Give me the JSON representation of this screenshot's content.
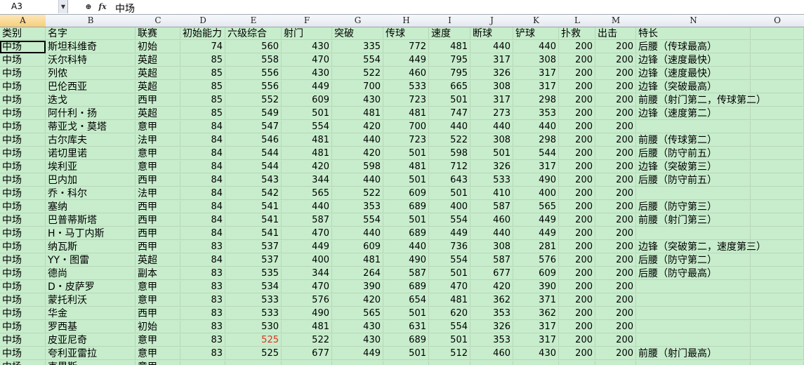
{
  "formula_bar": {
    "name_box": "A3",
    "content": "中场",
    "icons": [
      "zoom-icon",
      "function-icon"
    ]
  },
  "columns": [
    "A",
    "B",
    "C",
    "D",
    "E",
    "F",
    "G",
    "H",
    "I",
    "J",
    "K",
    "L",
    "M",
    "N",
    "O"
  ],
  "selected_column": "A",
  "header_row": [
    "类别",
    "名字",
    "联赛",
    "初始能力",
    "六级综合",
    "射门",
    "突破",
    "传球",
    "速度",
    "断球",
    "铲球",
    "扑救",
    "出击",
    "特长",
    ""
  ],
  "rows": [
    [
      "中场",
      "斯坦科维奇",
      "初始",
      "74",
      "560",
      "430",
      "335",
      "772",
      "481",
      "440",
      "440",
      "200",
      "200",
      "后腰（传球最高）"
    ],
    [
      "中场",
      "沃尔科特",
      "英超",
      "85",
      "558",
      "470",
      "554",
      "449",
      "795",
      "317",
      "308",
      "200",
      "200",
      "边锋（速度最快）"
    ],
    [
      "中场",
      "列侬",
      "英超",
      "85",
      "556",
      "430",
      "522",
      "460",
      "795",
      "326",
      "317",
      "200",
      "200",
      "边锋（速度最快）"
    ],
    [
      "中场",
      "巴伦西亚",
      "英超",
      "85",
      "556",
      "449",
      "700",
      "533",
      "665",
      "308",
      "317",
      "200",
      "200",
      "边锋（突破最高）"
    ],
    [
      "中场",
      "迭戈",
      "西甲",
      "85",
      "552",
      "609",
      "430",
      "723",
      "501",
      "317",
      "298",
      "200",
      "200",
      "前腰（射门第二，传球第二）"
    ],
    [
      "中场",
      "阿什利・扬",
      "英超",
      "85",
      "549",
      "501",
      "481",
      "481",
      "747",
      "273",
      "353",
      "200",
      "200",
      "边锋（速度第二）"
    ],
    [
      "中场",
      "蒂亚戈・莫塔",
      "意甲",
      "84",
      "547",
      "554",
      "420",
      "700",
      "440",
      "440",
      "440",
      "200",
      "200",
      ""
    ],
    [
      "中场",
      "古尔库夫",
      "法甲",
      "84",
      "546",
      "481",
      "440",
      "723",
      "522",
      "308",
      "298",
      "200",
      "200",
      "前腰（传球第二）"
    ],
    [
      "中场",
      "诺切里诺",
      "意甲",
      "84",
      "544",
      "481",
      "420",
      "501",
      "598",
      "501",
      "544",
      "200",
      "200",
      "后腰（防守前五）"
    ],
    [
      "中场",
      "埃利亚",
      "意甲",
      "84",
      "544",
      "420",
      "598",
      "481",
      "712",
      "326",
      "317",
      "200",
      "200",
      "边锋（突破第三）"
    ],
    [
      "中场",
      "巴内加",
      "西甲",
      "84",
      "543",
      "344",
      "440",
      "501",
      "643",
      "533",
      "490",
      "200",
      "200",
      "后腰（防守前五）"
    ],
    [
      "中场",
      "乔・科尔",
      "法甲",
      "84",
      "542",
      "565",
      "522",
      "609",
      "501",
      "410",
      "400",
      "200",
      "200",
      ""
    ],
    [
      "中场",
      "塞纳",
      "西甲",
      "84",
      "541",
      "440",
      "353",
      "689",
      "400",
      "587",
      "565",
      "200",
      "200",
      "后腰（防守第三）"
    ],
    [
      "中场",
      "巴普蒂斯塔",
      "西甲",
      "84",
      "541",
      "587",
      "554",
      "501",
      "554",
      "460",
      "449",
      "200",
      "200",
      "前腰（射门第三）"
    ],
    [
      "中场",
      "H・马丁内斯",
      "西甲",
      "84",
      "541",
      "470",
      "440",
      "689",
      "449",
      "440",
      "449",
      "200",
      "200",
      ""
    ],
    [
      "中场",
      "纳瓦斯",
      "西甲",
      "83",
      "537",
      "449",
      "609",
      "440",
      "736",
      "308",
      "281",
      "200",
      "200",
      "边锋（突破第二，速度第三）"
    ],
    [
      "中场",
      "YY・图雷",
      "英超",
      "84",
      "537",
      "400",
      "481",
      "490",
      "554",
      "587",
      "576",
      "200",
      "200",
      "后腰（防守第二）"
    ],
    [
      "中场",
      "德尚",
      "副本",
      "83",
      "535",
      "344",
      "264",
      "587",
      "501",
      "677",
      "609",
      "200",
      "200",
      "后腰（防守最高）"
    ],
    [
      "中场",
      "D・皮萨罗",
      "意甲",
      "83",
      "534",
      "470",
      "390",
      "689",
      "470",
      "420",
      "390",
      "200",
      "200",
      ""
    ],
    [
      "中场",
      "蒙托利沃",
      "意甲",
      "83",
      "533",
      "576",
      "420",
      "654",
      "481",
      "362",
      "371",
      "200",
      "200",
      ""
    ],
    [
      "中场",
      "华金",
      "西甲",
      "83",
      "533",
      "490",
      "565",
      "501",
      "620",
      "353",
      "362",
      "200",
      "200",
      ""
    ],
    [
      "中场",
      "罗西基",
      "初始",
      "83",
      "530",
      "481",
      "430",
      "631",
      "554",
      "326",
      "317",
      "200",
      "200",
      ""
    ],
    [
      "中场",
      "皮亚尼奇",
      "意甲",
      "83",
      "525",
      "522",
      "430",
      "689",
      "501",
      "353",
      "317",
      "200",
      "200",
      ""
    ],
    [
      "中场",
      "夸利亚雷拉",
      "意甲",
      "83",
      "525",
      "677",
      "449",
      "501",
      "512",
      "460",
      "430",
      "200",
      "200",
      "前腰（射门最高）"
    ],
    [
      "中场",
      "克里斯",
      "意甲",
      "",
      "",
      "",
      "",
      "",
      "",
      "",
      "",
      "",
      "",
      ""
    ]
  ],
  "highlight_cells": [
    {
      "row": 22,
      "col": 4,
      "color": "#e0301e"
    }
  ],
  "active_cell": {
    "row": 1,
    "col": 0
  }
}
